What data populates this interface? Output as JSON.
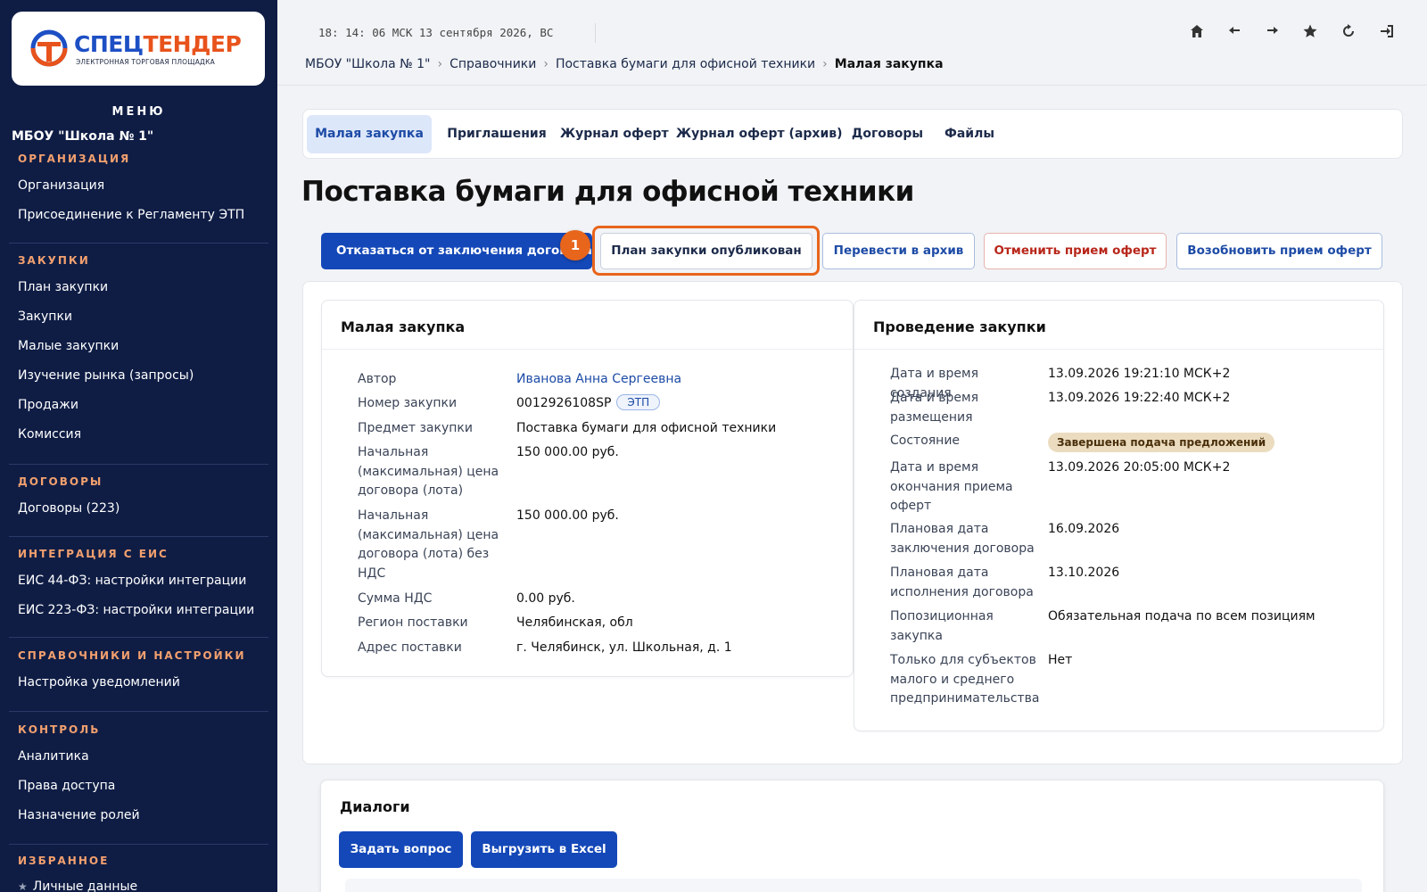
{
  "brand": {
    "name_part1": "СПЕЦ",
    "name_part2": "ТЕНДЕР",
    "subtitle": "ЭЛЕКТРОННАЯ ТОРГОВАЯ ПЛОЩАДКА",
    "color_blue": "#1d4fc4",
    "color_orange": "#e8531c"
  },
  "sidebar": {
    "menu_title": "МЕНЮ",
    "org_name": "МБОУ \"Школа № 1\"",
    "sections": [
      {
        "title": "ОРГАНИЗАЦИЯ",
        "items": [
          "Организация",
          "Присоединение к Регламенту ЭТП"
        ]
      },
      {
        "title": "ЗАКУПКИ",
        "items": [
          "План закупки",
          "Закупки",
          "Малые закупки",
          "Изучение рынка (запросы)",
          "Продажи",
          "Комиссия"
        ]
      },
      {
        "title": "ДОГОВОРЫ",
        "items": [
          "Договоры (223)"
        ]
      },
      {
        "title": "ИНТЕГРАЦИЯ С ЕИС",
        "items": [
          "ЕИС 44-ФЗ: настройки интеграции",
          "ЕИС 223-ФЗ: настройки интеграции"
        ]
      },
      {
        "title": "СПРАВОЧНИКИ И НАСТРОЙКИ",
        "items": [
          "Настройка уведомлений"
        ]
      },
      {
        "title": "КОНТРОЛЬ",
        "items": [
          "Аналитика",
          "Права доступа",
          "Назначение ролей"
        ]
      },
      {
        "title": "ИЗБРАННОЕ",
        "items": [
          "Личные данные"
        ]
      }
    ],
    "favorite_star": "★"
  },
  "header": {
    "clock": "18: 14: 06 МСК  13 сентября 2026, ВС",
    "icons": [
      "home-icon",
      "back-arrow-icon",
      "forward-arrow-icon",
      "star-icon",
      "refresh-icon",
      "logout-icon"
    ],
    "breadcrumb": [
      "МБОУ \"Школа № 1\"",
      "Справочники",
      "Поставка бумаги для офисной техники",
      "Малая закупка"
    ],
    "breadcrumb_sep": "›"
  },
  "tabs": [
    "Малая закупка",
    "Приглашения",
    "Журнал оферт",
    "Журнал оферт (архив)",
    "Договоры",
    "Файлы"
  ],
  "page_title": "Поставка бумаги для офисной техники",
  "actions": {
    "refuse": "Отказаться от заключения договора",
    "plan_published": "План закупки опубликован",
    "archive": "Перевести в архив",
    "cancel_offers": "Отменить прием оферт",
    "resume_offers": "Возобновить прием оферт",
    "step_number": "1",
    "highlight_color": "#e8651c"
  },
  "small_purchase": {
    "title": "Малая закупка",
    "fields": [
      {
        "label": "Автор",
        "value": "Иванова Анна Сергеевна"
      },
      {
        "label": "Номер закупки",
        "value": "0012926108SP",
        "tag": "ЭТП"
      },
      {
        "label": "Предмет закупки",
        "value": "Поставка бумаги для офисной техники"
      },
      {
        "label": "Начальная (максимальная) цена договора (лота)",
        "value": "150 000.00 руб."
      },
      {
        "label": "Начальная (максимальная) цена договора (лота) без НДС",
        "value": "150 000.00 руб."
      },
      {
        "label": "Сумма НДС",
        "value": "0.00 руб."
      },
      {
        "label": "Регион поставки",
        "value": "Челябинская, обл"
      },
      {
        "label": "Адрес поставки",
        "value": "г. Челябинск, ул. Школьная, д. 1"
      }
    ]
  },
  "conduct": {
    "title": "Проведение закупки",
    "fields": [
      {
        "label": "Дата и время создания",
        "value": "13.09.2026 19:21:10 МСК+2"
      },
      {
        "label": "Дата и время размещения",
        "value": "13.09.2026 19:22:40 МСК+2"
      },
      {
        "label": "Состояние",
        "value": "Завершена подача предложений"
      },
      {
        "label": "Дата и время окончания приема оферт",
        "value": "13.09.2026 20:05:00 МСК+2"
      },
      {
        "label": "Плановая дата заключения договора",
        "value": "16.09.2026"
      },
      {
        "label": "Плановая дата исполнения договора",
        "value": "13.10.2026"
      },
      {
        "label": "Попозиционная закупка",
        "value": "Обязательная подача по всем позициям"
      },
      {
        "label": "Только для субъектов малого и среднего предпринимательства",
        "value": "Нет"
      }
    ]
  },
  "dialogs": {
    "title": "Диалоги",
    "ask_button": "Задать вопрос",
    "export_button": "Выгрузить в Excel"
  }
}
